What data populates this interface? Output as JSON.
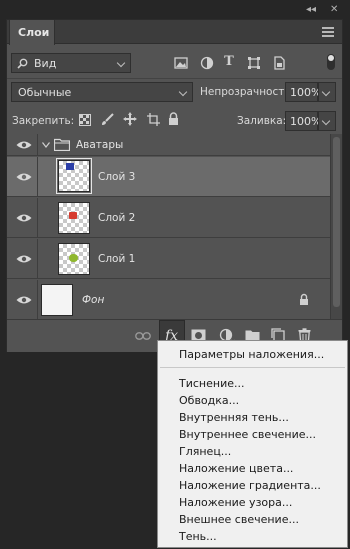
{
  "window": {
    "collapse_label": "◂◂",
    "close_label": "✕"
  },
  "panel": {
    "tab_label": "Слои",
    "filter": {
      "value": "Вид"
    },
    "blend_mode": {
      "value": "Обычные"
    },
    "opacity": {
      "label": "Непрозрачность:",
      "value": "100%"
    },
    "lock": {
      "label": "Закрепить:"
    },
    "fill": {
      "label": "Заливка:",
      "value": "100%"
    },
    "layers": [
      {
        "name": "Аватары",
        "type": "group",
        "visible": true
      },
      {
        "name": "Слой 3",
        "type": "layer",
        "selected": true,
        "icon_color": "#2c3fa8"
      },
      {
        "name": "Слой 2",
        "type": "layer",
        "icon_color": "#d63b2f"
      },
      {
        "name": "Слой 1",
        "type": "layer",
        "icon_color": "#8fb72e"
      },
      {
        "name": "Фон",
        "type": "background",
        "locked": true
      }
    ]
  },
  "toolbar": {
    "fx_label": "fx"
  },
  "fx_menu": {
    "items": [
      "Параметры наложения...",
      "Тиснение...",
      "Обводка...",
      "Внутренняя тень...",
      "Внутреннее свечение...",
      "Глянец...",
      "Наложение цвета...",
      "Наложение градиента...",
      "Наложение узора...",
      "Внешнее свечение...",
      "Тень..."
    ]
  },
  "colors": {
    "panel_bg": "#535353",
    "selected_row": "#6b6b6b",
    "menu_bg": "#f0f0f0"
  }
}
